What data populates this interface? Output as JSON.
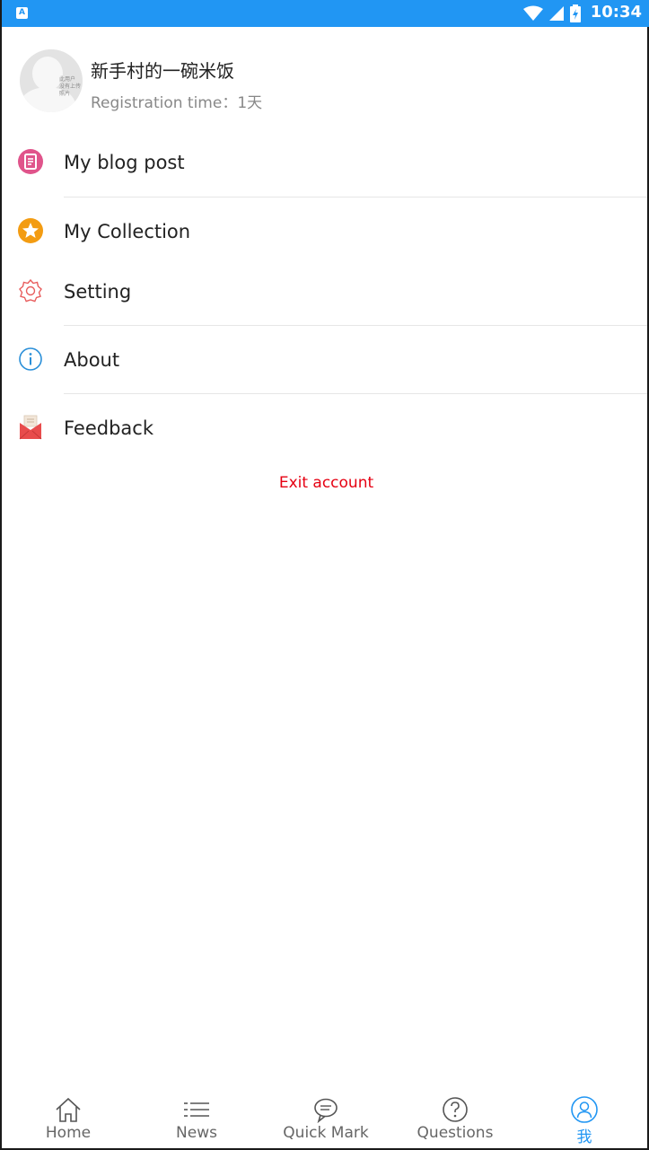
{
  "status_bar": {
    "app_badge": "A",
    "time": "10:34",
    "icons": [
      "wifi-icon",
      "signal-icon",
      "battery-icon"
    ]
  },
  "profile": {
    "username": "新手村的一碗米饭",
    "registration": "Registration time：1天",
    "avatar_tag": "此用户没有上传照片"
  },
  "menu": [
    {
      "label": "My blog post",
      "icon": "blog-post-icon",
      "color": "#e0548b"
    },
    {
      "label": "My Collection",
      "icon": "star-icon",
      "color": "#f39c12"
    },
    {
      "label": "Setting",
      "icon": "gear-icon",
      "color": "#e85d5d"
    },
    {
      "label": "About",
      "icon": "info-icon",
      "color": "#2a8fd8"
    },
    {
      "label": "Feedback",
      "icon": "mail-icon",
      "color": "#e84c4c"
    }
  ],
  "exit_label": "Exit account",
  "tabs": [
    {
      "label": "Home",
      "icon": "home-icon"
    },
    {
      "label": "News",
      "icon": "list-icon"
    },
    {
      "label": "Quick Mark",
      "icon": "chat-icon"
    },
    {
      "label": "Questions",
      "icon": "question-icon"
    },
    {
      "label": "我",
      "icon": "user-icon",
      "active": true
    }
  ],
  "colors": {
    "accent": "#2196f3",
    "danger": "#e60012"
  }
}
